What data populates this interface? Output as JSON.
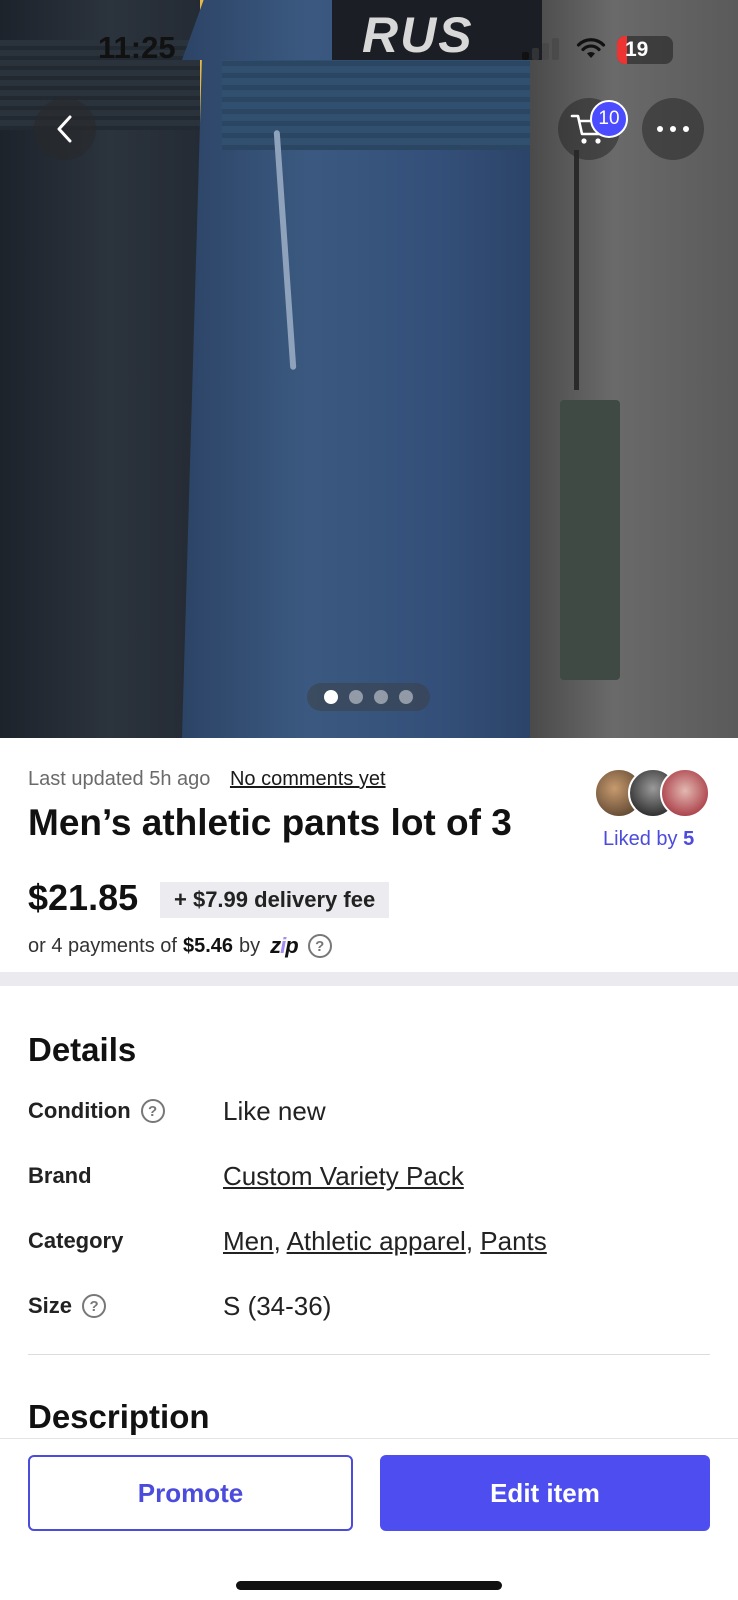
{
  "status_bar": {
    "time": "11:25",
    "battery": "19"
  },
  "hero": {
    "label_text": "RUS",
    "dots_total": 4,
    "active_dot": 1
  },
  "nav": {
    "back_icon": "chevron-left-icon",
    "cart_icon": "cart-icon",
    "cart_count": "10",
    "more_icon": "more-horizontal-icon"
  },
  "listing": {
    "last_updated": "Last updated 5h ago",
    "comments_link": "No comments yet",
    "title": "Men’s athletic pants lot of 3",
    "liked_prefix": "Liked by",
    "liked_count": "5",
    "price": "$21.85",
    "delivery_fee": "+ $7.99 delivery fee",
    "payments_prefix": "or 4 payments of",
    "payments_amount": "$5.46",
    "payments_by": "by",
    "zip_logo": "zip"
  },
  "details": {
    "title": "Details",
    "condition_label": "Condition",
    "condition_value": "Like new",
    "brand_label": "Brand",
    "brand_value": "Custom Variety Pack",
    "category_label": "Category",
    "category_values": [
      "Men",
      "Athletic apparel",
      "Pants"
    ],
    "size_label": "Size",
    "size_value": "S (34-36)"
  },
  "description": {
    "title": "Description"
  },
  "actions": {
    "promote": "Promote",
    "edit": "Edit item"
  },
  "colors": {
    "accent": "#4d4df0",
    "link_purple": "#4b4bdc"
  }
}
